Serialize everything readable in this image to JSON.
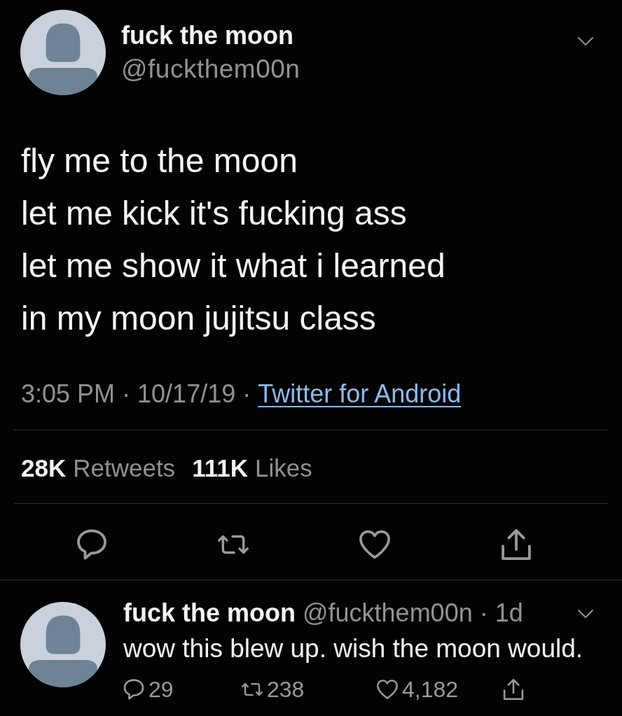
{
  "tweet": {
    "author": {
      "name": "fuck the moon",
      "handle": "@fuckthem00n"
    },
    "lines": [
      "fly me to the moon",
      "let me kick it's fucking ass",
      "let me show it what i learned",
      "in my moon jujitsu class"
    ],
    "meta": {
      "time_date": "3:05 PM · 10/17/19 ·",
      "source": "Twitter for Android"
    },
    "stats": [
      {
        "count": "28K",
        "label": "Retweets"
      },
      {
        "count": "111K",
        "label": "Likes"
      }
    ],
    "actions": [
      {
        "kind": "reply"
      },
      {
        "kind": "retweet"
      },
      {
        "kind": "like"
      },
      {
        "kind": "share"
      }
    ]
  },
  "reply": {
    "author": {
      "name": "fuck the moon",
      "handle_time": "@fuckthem00n · 1d"
    },
    "text": "wow this blew up. wish the moon would.",
    "actions": [
      {
        "kind": "reply",
        "count": "29"
      },
      {
        "kind": "retweet",
        "count": "238"
      },
      {
        "kind": "like",
        "count": "4,182"
      },
      {
        "kind": "share"
      }
    ]
  }
}
